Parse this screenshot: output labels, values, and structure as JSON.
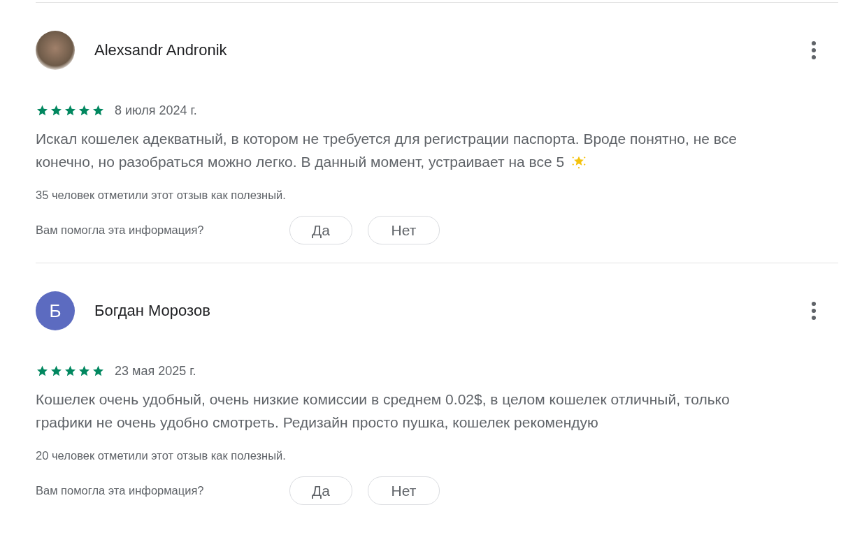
{
  "reviews": [
    {
      "author": "Alexsandr Andronik",
      "avatar": {
        "kind": "photo"
      },
      "stars": 5,
      "date": "8 июля 2024 г.",
      "text": "Искал кошелек адекватный, в котором не требуется для регистрации паспорта. Вроде понятно, не все конечно, но разобраться можно легко. В данный момент, устраивает на все 5",
      "ends_with_star_emoji": true,
      "helpful_count": "35 человек отметили этот отзыв как полезный.",
      "helpful_question": "Вам помогла эта информация?",
      "buttons": [
        "Да",
        "Нет"
      ]
    },
    {
      "author": "Богдан Морозов",
      "avatar": {
        "kind": "letter",
        "letter": "Б",
        "color": "#5c6bc0"
      },
      "stars": 5,
      "date": "23 мая 2025 г.",
      "text": "Кошелек очень удобный, очень низкие комиссии в среднем 0.02$, в целом кошелек отличный, только графики не очень удобно смотреть. Редизайн просто пушка, кошелек рекомендую",
      "ends_with_star_emoji": false,
      "helpful_count": "20 человек отметили этот отзыв как полезный.",
      "helpful_question": "Вам помогла эта информация?",
      "buttons": [
        "Да",
        "Нет"
      ]
    }
  ]
}
